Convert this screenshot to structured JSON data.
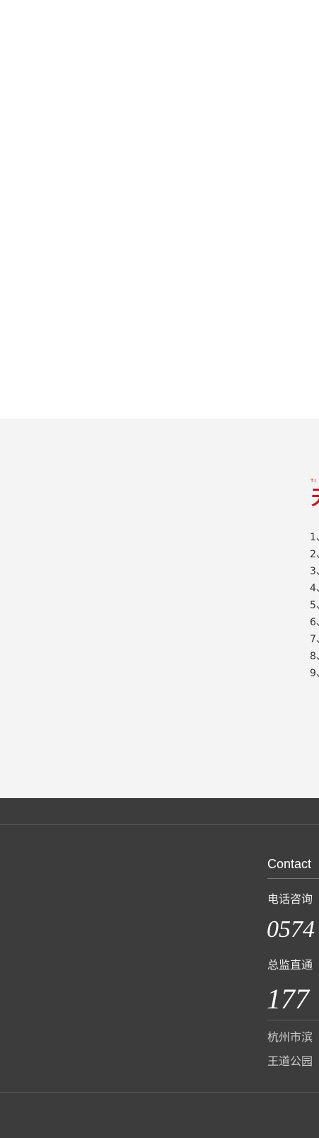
{
  "about": {
    "eyebrow": "TI",
    "title": "天",
    "items": [
      "1、",
      "2、",
      "3、",
      "4、",
      "5、",
      "6、",
      "7、",
      "8、",
      "9、"
    ]
  },
  "footer": {
    "contact_label": "Contact",
    "phone_consult_label": "电话咨询",
    "phone_consult_number": "0574",
    "director_label": "总监直通",
    "director_number": "177",
    "address_line1": "杭州市滨",
    "address_line2": "王道公园"
  }
}
